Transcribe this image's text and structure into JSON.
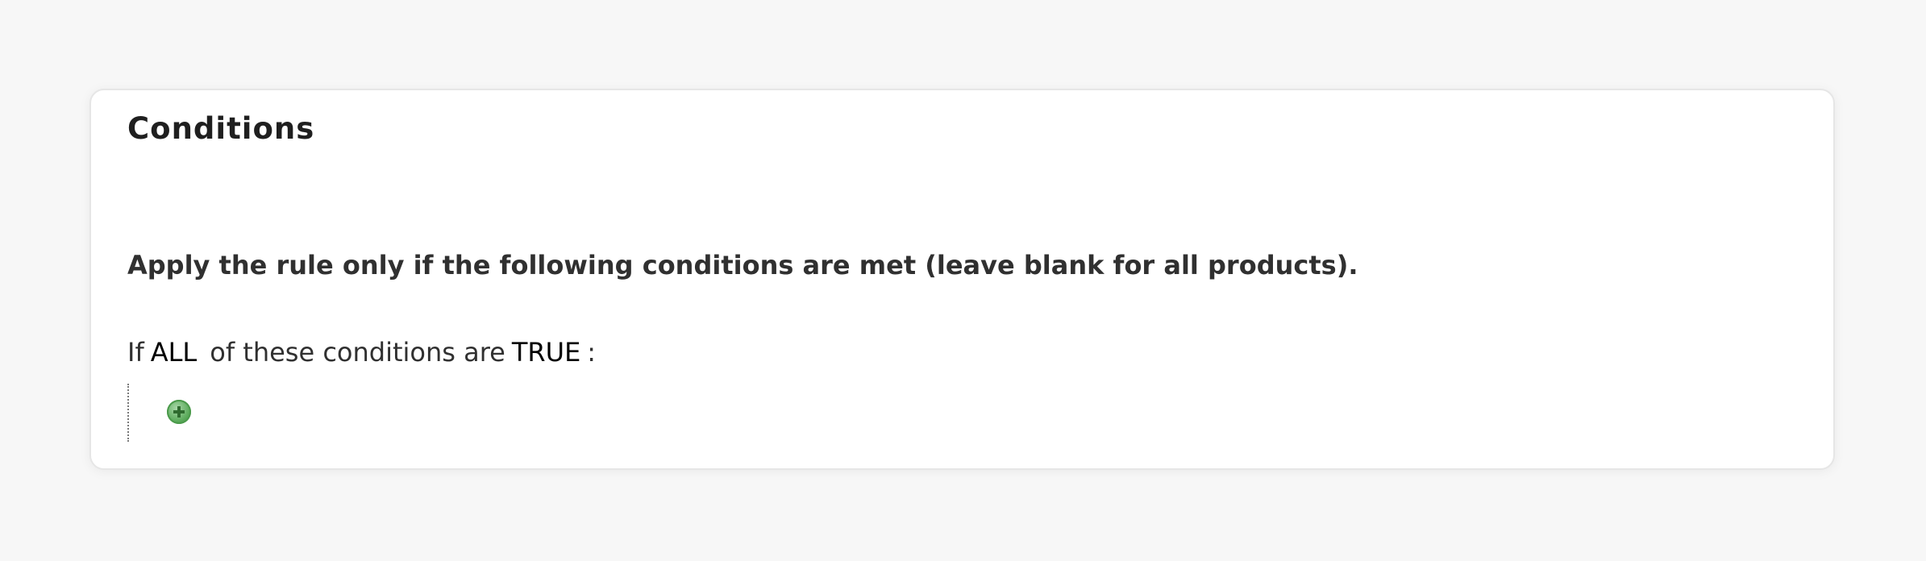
{
  "section": {
    "title": "Conditions",
    "description": "Apply the rule only if the following conditions are met (leave blank for all products).",
    "condition_prefix": "If",
    "aggregator_value": "ALL",
    "condition_middle": "of these conditions are",
    "value_token": "TRUE",
    "condition_suffix": ":"
  },
  "icons": {
    "add_condition": "add-circle-icon"
  },
  "colors": {
    "page_background": "#f7f7f7",
    "panel_background": "#ffffff",
    "add_icon": "#5cab5c"
  }
}
